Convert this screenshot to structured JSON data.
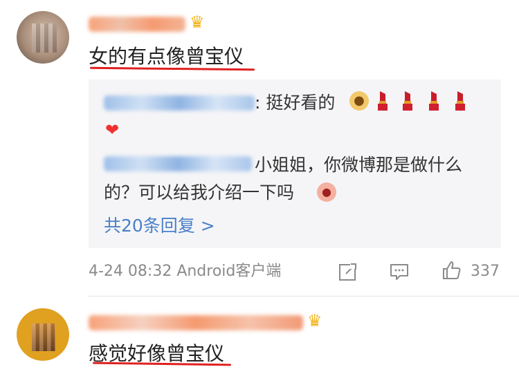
{
  "comments": [
    {
      "text": "女的有点像曾宝仪",
      "replies": {
        "first": {
          "text": ": 挺好看的"
        },
        "second": {
          "text": "小姐姐，你微博那是做什么",
          "text_cont": "的？可以给我介绍一下吗"
        },
        "more_label": "共20条回复 >"
      },
      "meta": {
        "time_source": "4-24 08:32 Android客户端",
        "like_count": "337"
      }
    },
    {
      "text": "感觉好像曾宝仪"
    }
  ],
  "icons": {
    "crown": "crown-icon",
    "share": "share-icon",
    "comment": "comment-icon",
    "like": "thumbs-up-icon",
    "heart": "heart-emoji-icon",
    "lipstick": "lipstick-emoji-icon",
    "dog": "dog-face-emoji-icon",
    "face": "face-emoji-icon"
  },
  "colors": {
    "link": "#4a7fc8",
    "underline": "#e02020",
    "meta": "#8a8a8a",
    "reply_bg": "#f5f5f7"
  }
}
